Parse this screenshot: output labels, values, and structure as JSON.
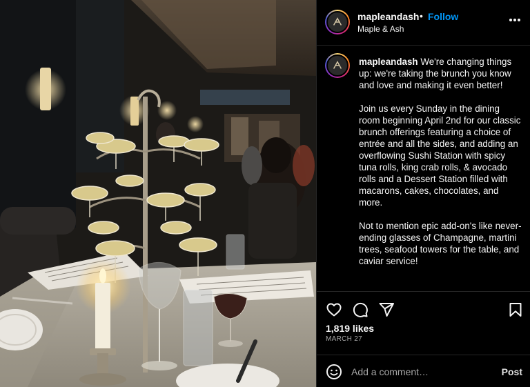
{
  "post": {
    "image_alt": "Restaurant dining table with champagne coupe tower, candles and menus",
    "header": {
      "username": "mapleandash",
      "separator": "•",
      "follow_label": "Follow",
      "location": "Maple & Ash",
      "avatar_icon": "maple-ash-logo-icon",
      "more_icon": "more-options-icon"
    },
    "caption": {
      "username": "mapleandash",
      "paragraphs": [
        "We're changing things up: we're taking the brunch you know and love and making it even better!",
        "Join us every Sunday in the dining room beginning April 2nd for our classic brunch offerings featuring a choice of entrée and all the sides, and adding an overflowing Sushi Station with spicy tuna rolls, king crab rolls, & avocado rolls and a Dessert Station filled with macarons, cakes, chocolates, and more.",
        "Not to mention epic add-on's like never-ending glasses of Champagne, martini trees, seafood towers for the table, and caviar service!"
      ]
    },
    "actions": {
      "like_icon": "heart-icon",
      "comment_icon": "comment-icon",
      "share_icon": "share-icon",
      "save_icon": "bookmark-icon"
    },
    "likes": "1,819 likes",
    "date": "MARCH 27",
    "comment": {
      "emoji_icon": "emoji-icon",
      "placeholder": "Add a comment…",
      "post_label": "Post"
    }
  },
  "colors": {
    "background": "#000000",
    "text": "#f5f5f5",
    "follow": "#0095f6",
    "muted": "#a8a8a8",
    "divider": "#262626"
  }
}
